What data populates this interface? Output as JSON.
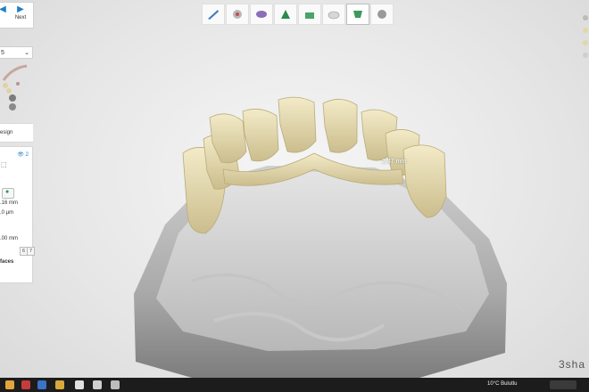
{
  "nav": {
    "next_label": "Next"
  },
  "left_panel": {
    "select_value": "5",
    "design_label": "esign",
    "eye_label": "2",
    "value_1": ".16 mm",
    "value_2": ".0 µm",
    "value_3": ".00 mm",
    "num_6": "6",
    "num_7": "7",
    "faces_label": "faces"
  },
  "viewport": {
    "measure_label": "2.47 mm",
    "brand_label": "3sha"
  },
  "taskbar": {
    "weather": "10°C  Bulutlu"
  },
  "icons": {
    "back": "back-arrow-icon",
    "next": "next-arrow-icon",
    "tools": [
      "knife-icon",
      "scan-tool-icon",
      "tooth-tool-icon",
      "gingiva-tool-icon",
      "margin-tool-icon",
      "crown-tool-icon",
      "shield-tool-icon",
      "sphere-tool-icon"
    ]
  },
  "colors": {
    "accent": "#1f7fc9",
    "tooth": "#e9dfb9",
    "model": "#bdbdbd",
    "taskbar": "#1c1c1c"
  }
}
